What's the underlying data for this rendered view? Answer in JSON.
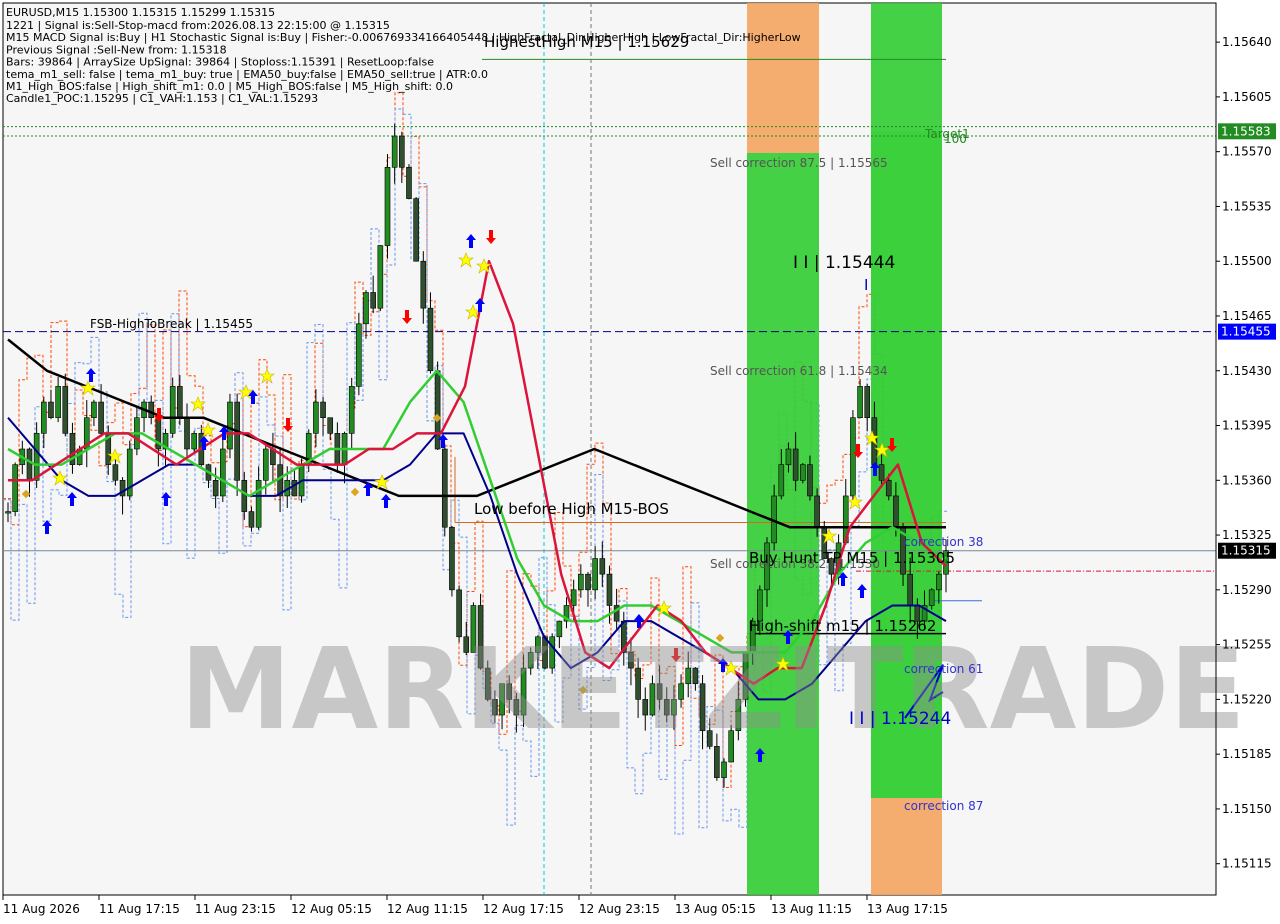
{
  "header": {
    "symbol_line": "EURUSD,M15  1.15300 1.15315 1.15299 1.15315",
    "info_lines": [
      "1221 | Signal is:Sell-Stop-macd from:2026.08.13 22:15:00 @ 1.15315",
      "M15 MACD Signal is:Buy | H1 Stochastic Signal is:Buy | Fisher:-0.006769334166405448 | HighFractal_Dir:HigherHigh | LowFractal_Dir:HigherLow",
      "Previous Signal :Sell-New from: 1.15318",
      "Bars: 39864 | ArraySize UpSignal: 39864 | Stoploss:1.15391 | ResetLoop:false",
      "tema_m1_sell: false | tema_m1_buy: true | EMA50_buy:false | EMA50_sell:true | ATR:0.0",
      "M1_High_BOS:false | High_shift_m1: 0.0 | M5_High_BOS:false | M5_High_shift: 0.0",
      "Candle1_POC:1.15295 | C1_VAH:1.153 | C1_VAL:1.15293"
    ]
  },
  "watermark": "MARKETZITRADE",
  "colors": {
    "bull": "#228b22",
    "bear": "#2f4f2f",
    "ema_red": "#dc143c",
    "ema_green": "#32cd32",
    "ema_navy": "#00008b",
    "ema_black": "#000000",
    "zone_green": "#32cd32",
    "zone_orange": "#f4a460",
    "level_blue": "#00008b",
    "target": "#228b22"
  },
  "annotations": {
    "highest_high": "HighestHigh   M15 | 1.15629",
    "fsb": "FSB-HighToBreak | 1.15455",
    "sell_corr_875": "Sell correction 87.5 | 1.15565",
    "sell_corr_618": "Sell correction 61.8 | 1.15434",
    "sell_corr_382": "Sell correction 38.2 | 1.1530",
    "l1": "I I | 1.15444",
    "l1_mark": "I",
    "l2": "I I | 1.15244",
    "low_before_high": "Low before High   M15-BOS",
    "buy_hunt": "Buy Hunt TP M15 | 1.15305",
    "high_shift": "High-shift m15 | 1.15262",
    "target1": "Target1",
    "target_100": "100",
    "corr38": "correction 38",
    "corr61": "correction 61",
    "corr87": "correction 87"
  },
  "price_badges": {
    "target": "1.15583",
    "fsb": "1.15455",
    "current": "1.15315"
  },
  "chart_data": {
    "type": "candlestick",
    "symbol": "EURUSD",
    "timeframe": "M15",
    "ylim": [
      1.15095,
      1.15665
    ],
    "y_ticks": [
      "1.15640",
      "1.15605",
      "1.15570",
      "1.15535",
      "1.15500",
      "1.15465",
      "1.15430",
      "1.15395",
      "1.15360",
      "1.15325",
      "1.15290",
      "1.15255",
      "1.15220",
      "1.15185",
      "1.15150",
      "1.15115"
    ],
    "x_ticks": [
      "11 Aug 2026",
      "11 Aug 17:15",
      "11 Aug 23:15",
      "12 Aug 05:15",
      "12 Aug 11:15",
      "12 Aug 17:15",
      "12 Aug 23:15",
      "13 Aug 05:15",
      "13 Aug 11:15",
      "13 Aug 17:15"
    ],
    "levels": {
      "highest_high": 1.15629,
      "fsb_high_to_break": 1.15455,
      "target1": 1.15583,
      "current": 1.15315,
      "buy_hunt_tp": 1.15305,
      "high_shift": 1.15262
    },
    "close_path": [
      1.1534,
      1.1537,
      1.1538,
      1.1536,
      1.1539,
      1.1541,
      1.154,
      1.1542,
      1.1539,
      1.1537,
      1.1538,
      1.154,
      1.1541,
      1.1539,
      1.1537,
      1.1536,
      1.1535,
      1.1538,
      1.154,
      1.1541,
      1.154,
      1.1538,
      1.1539,
      1.1542,
      1.154,
      1.1538,
      1.1539,
      1.1537,
      1.1536,
      1.1535,
      1.1538,
      1.1541,
      1.1536,
      1.1534,
      1.1533,
      1.1536,
      1.1538,
      1.1537,
      1.1535,
      1.1536,
      1.1535,
      1.1537,
      1.1539,
      1.1541,
      1.154,
      1.1539,
      1.1537,
      1.1539,
      1.1542,
      1.1546,
      1.1548,
      1.1547,
      1.1551,
      1.1556,
      1.1558,
      1.1556,
      1.1554,
      1.155,
      1.1547,
      1.1543,
      1.1538,
      1.1533,
      1.1529,
      1.1526,
      1.1525,
      1.1528,
      1.1524,
      1.1522,
      1.1521,
      1.1523,
      1.1522,
      1.1521,
      1.1524,
      1.1525,
      1.1526,
      1.1524,
      1.1526,
      1.1527,
      1.1528,
      1.1529,
      1.153,
      1.1529,
      1.1531,
      1.153,
      1.1528,
      1.1527,
      1.1525,
      1.1524,
      1.1522,
      1.1521,
      1.1523,
      1.1522,
      1.1521,
      1.1522,
      1.1523,
      1.1524,
      1.1523,
      1.152,
      1.1519,
      1.1517,
      1.1518,
      1.152,
      1.1522,
      1.1525,
      1.1527,
      1.1529,
      1.1532,
      1.1535,
      1.1537,
      1.1538,
      1.1536,
      1.1537,
      1.1535,
      1.1533,
      1.1531,
      1.153,
      1.1532,
      1.1535,
      1.154,
      1.1542,
      1.154,
      1.1537,
      1.1536,
      1.1535,
      1.1533,
      1.153,
      1.1528,
      1.1527,
      1.1528,
      1.1529,
      1.153,
      1.15315
    ],
    "ema_red": [
      1.1536,
      1.1536,
      1.1537,
      1.1538,
      1.1539,
      1.1539,
      1.1538,
      1.1537,
      1.1538,
      1.1539,
      1.1539,
      1.1538,
      1.1537,
      1.1537,
      1.1537,
      1.1538,
      1.1538,
      1.1539,
      1.1539,
      1.1542,
      1.155,
      1.1546,
      1.1538,
      1.153,
      1.1525,
      1.1524,
      1.1526,
      1.1528,
      1.1527,
      1.1525,
      1.1524,
      1.1523,
      1.1524,
      1.1524,
      1.1528,
      1.1533,
      1.1535,
      1.1537,
      1.1532,
      1.15305
    ],
    "ema_green": [
      1.1538,
      1.1537,
      1.1537,
      1.1538,
      1.1539,
      1.1539,
      1.1538,
      1.1537,
      1.1536,
      1.1535,
      1.1536,
      1.1537,
      1.1538,
      1.1538,
      1.1538,
      1.1541,
      1.1543,
      1.1541,
      1.1536,
      1.1531,
      1.1528,
      1.1527,
      1.1527,
      1.1528,
      1.1528,
      1.1527,
      1.1526,
      1.1525,
      1.1525,
      1.1525,
      1.1527,
      1.153,
      1.1532,
      1.1533,
      1.1532,
      1.1531
    ],
    "ema_navy": [
      1.154,
      1.1538,
      1.1536,
      1.1535,
      1.1535,
      1.1536,
      1.1537,
      1.1537,
      1.1536,
      1.1535,
      1.1535,
      1.1536,
      1.1536,
      1.1536,
      1.1536,
      1.1537,
      1.1539,
      1.1539,
      1.1535,
      1.153,
      1.1526,
      1.1524,
      1.1525,
      1.1527,
      1.1527,
      1.1526,
      1.1525,
      1.1524,
      1.1522,
      1.1522,
      1.1523,
      1.1525,
      1.1527,
      1.1528,
      1.1528,
      1.1527
    ],
    "ema_black": [
      1.1545,
      1.1543,
      1.1542,
      1.1541,
      1.154,
      1.154,
      1.1539,
      1.1538,
      1.1537,
      1.1536,
      1.1535,
      1.1535,
      1.1535,
      1.1536,
      1.1537,
      1.1538,
      1.1537,
      1.1536,
      1.1535,
      1.1534,
      1.1533,
      1.1533,
      1.1533,
      1.1533,
      1.1533
    ]
  }
}
